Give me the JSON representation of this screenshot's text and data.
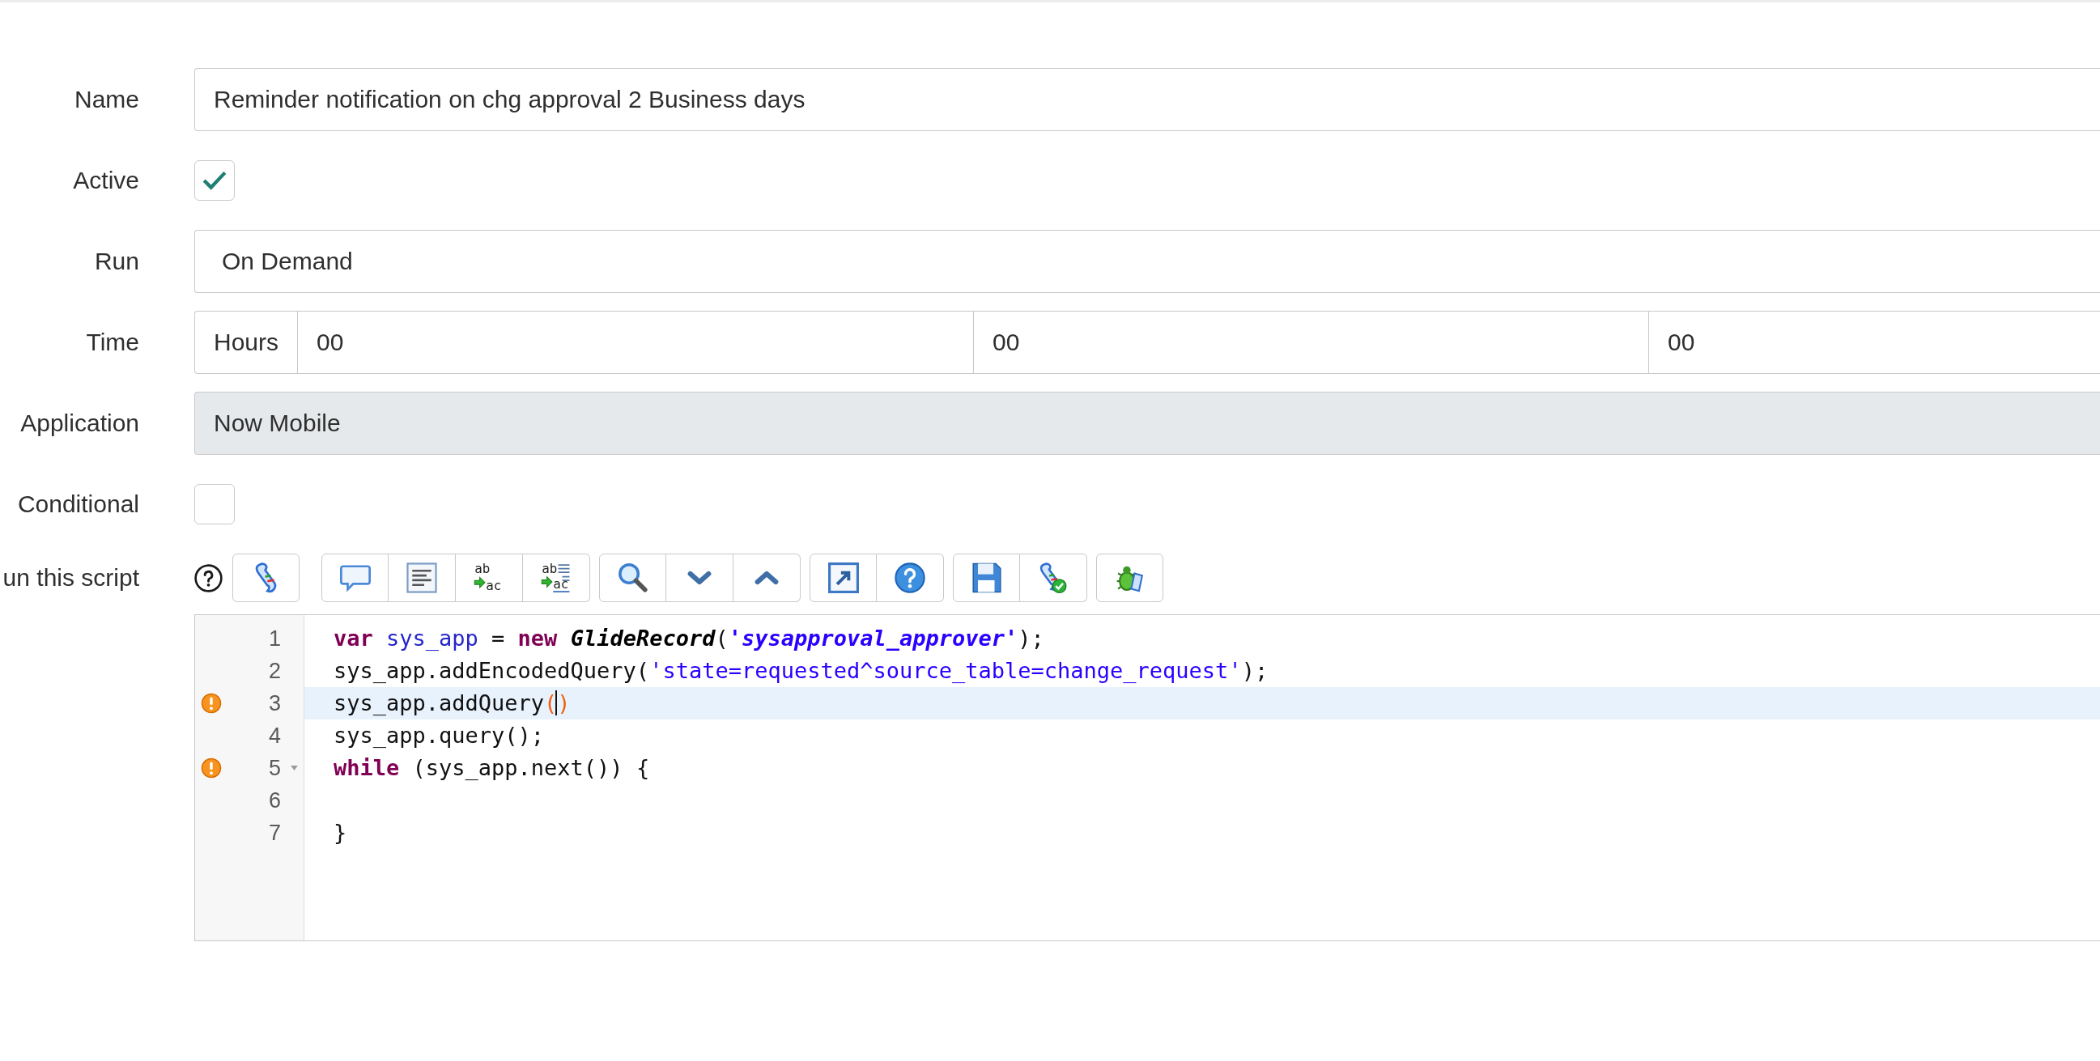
{
  "fields": [
    {
      "kind": "text",
      "label": "Name",
      "value": "Reminder notification on chg approval 2 Business days",
      "readonly": false
    },
    {
      "kind": "checkbox",
      "label": "Active",
      "checked": true
    },
    {
      "kind": "select",
      "label": "Run",
      "value": "On Demand"
    },
    {
      "kind": "time",
      "label": "Time",
      "addon": "Hours",
      "values": [
        "00",
        "00",
        "00"
      ]
    },
    {
      "kind": "text",
      "label": "Application",
      "value": "Now Mobile",
      "readonly": true
    },
    {
      "kind": "checkbox",
      "label": "Conditional",
      "checked": false
    }
  ],
  "script": {
    "label": "un this script",
    "toolbar": {
      "groups": [
        {
          "buttons": [
            {
              "kind": "script"
            }
          ]
        },
        {
          "buttons": [
            {
              "kind": "comment"
            },
            {
              "kind": "format"
            },
            {
              "kind": "replace",
              "glyphs": [
                "ab",
                "ac"
              ]
            },
            {
              "kind": "replace-all",
              "glyphs": [
                "ab",
                "ac"
              ]
            }
          ]
        },
        {
          "buttons": [
            {
              "kind": "search"
            },
            {
              "kind": "next"
            },
            {
              "kind": "previous"
            }
          ]
        },
        {
          "buttons": [
            {
              "kind": "fullscreen"
            },
            {
              "kind": "help"
            }
          ]
        },
        {
          "buttons": [
            {
              "kind": "save"
            },
            {
              "kind": "check"
            }
          ]
        },
        {
          "buttons": [
            {
              "kind": "debug"
            }
          ]
        }
      ]
    },
    "editor": {
      "lines": [
        {
          "number": "1",
          "active": false,
          "warning": false,
          "foldable": false,
          "tokens": [
            {
              "kind": "keyword",
              "text": "var"
            },
            {
              "kind": "variable",
              "text": " sys_app"
            },
            {
              "kind": "plain",
              "text": " = "
            },
            {
              "kind": "keyword",
              "text": "new"
            },
            {
              "kind": "class",
              "text": " GlideRecord"
            },
            {
              "kind": "plain",
              "text": "("
            },
            {
              "kind": "string-emph",
              "text": "'sysapproval_approver'"
            },
            {
              "kind": "plain",
              "text": ");"
            }
          ]
        },
        {
          "number": "2",
          "active": false,
          "warning": false,
          "foldable": false,
          "tokens": [
            {
              "kind": "plain",
              "text": "sys_app.addEncodedQuery("
            },
            {
              "kind": "string",
              "text": "'state=requested^source_table=change_request'"
            },
            {
              "kind": "plain",
              "text": ");"
            }
          ]
        },
        {
          "number": "3",
          "active": true,
          "warning": true,
          "foldable": false,
          "tokens": [
            {
              "kind": "plain",
              "text": "sys_app.addQuery"
            },
            {
              "kind": "bracket",
              "text": "("
            },
            {
              "kind": "cursor"
            },
            {
              "kind": "bracket",
              "text": ")"
            }
          ]
        },
        {
          "number": "4",
          "active": false,
          "warning": false,
          "foldable": false,
          "tokens": [
            {
              "kind": "plain",
              "text": "sys_app.query();"
            }
          ]
        },
        {
          "number": "5",
          "active": false,
          "warning": true,
          "foldable": true,
          "tokens": [
            {
              "kind": "keyword",
              "text": "while"
            },
            {
              "kind": "plain",
              "text": " (sys_app.next()) {"
            }
          ]
        },
        {
          "number": "6",
          "active": false,
          "warning": false,
          "foldable": false
        },
        {
          "number": "7",
          "active": false,
          "warning": false,
          "foldable": false,
          "tokens": [
            {
              "kind": "plain",
              "text": "}"
            }
          ]
        }
      ]
    }
  }
}
